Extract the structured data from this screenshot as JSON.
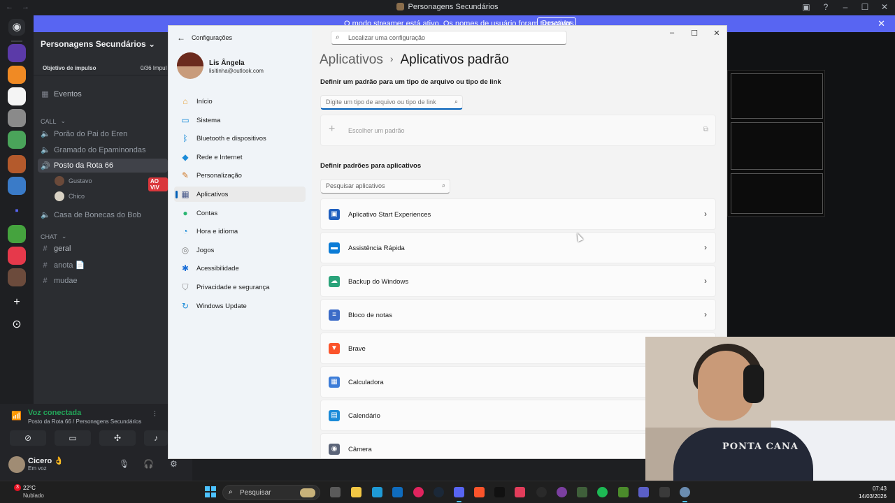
{
  "discord": {
    "window_title": "Personagens Secundários",
    "banner": {
      "text": "O modo streamer está ativo. Os nomes de usuário foram truncados.",
      "button": "Desativar"
    },
    "server_name": "Personagens Secundários",
    "boost": {
      "label": "Objetivo de impulso",
      "count": "0/36 Impul"
    },
    "channels": {
      "events": "Eventos",
      "call_category": "CALL",
      "voice": [
        "Porão do Pai do Eren",
        "Gramado do Epaminondas",
        "Posto da Rota 66"
      ],
      "voice_users": [
        "Gustavo",
        "Chico"
      ],
      "live_badge": "AO VIV",
      "voice_extra": "Casa de Bonecas do Bob",
      "chat_category": "CHAT",
      "text": [
        "geral",
        "anota 📄",
        "mudae"
      ]
    },
    "voice_panel": {
      "title": "Voz conectada",
      "subtitle": "Posto da Rota 66 / Personagens Secundários"
    },
    "user": {
      "name": "Cicero 👌",
      "status": "Em voz"
    }
  },
  "settings": {
    "app_title": "Configurações",
    "search_placeholder": "Localizar uma configuração",
    "profile": {
      "name": "Lis Ângela",
      "email": "lisitinha@outlook.com"
    },
    "nav": [
      {
        "label": "Início",
        "icon": "home-icon",
        "color": "#e8a33c"
      },
      {
        "label": "Sistema",
        "icon": "system-icon",
        "color": "#0a84d6"
      },
      {
        "label": "Bluetooth e dispositivos",
        "icon": "bluetooth-icon",
        "color": "#0a84d6"
      },
      {
        "label": "Rede e Internet",
        "icon": "wifi-icon",
        "color": "#1b8bd8"
      },
      {
        "label": "Personalização",
        "icon": "brush-icon",
        "color": "#d17a2a"
      },
      {
        "label": "Aplicativos",
        "icon": "apps-icon",
        "color": "#4a5b8c"
      },
      {
        "label": "Contas",
        "icon": "account-icon",
        "color": "#2bb673"
      },
      {
        "label": "Hora e idioma",
        "icon": "globe-clock-icon",
        "color": "#1b8bd8"
      },
      {
        "label": "Jogos",
        "icon": "gamepad-icon",
        "color": "#808080"
      },
      {
        "label": "Acessibilidade",
        "icon": "accessibility-icon",
        "color": "#1b6fd8"
      },
      {
        "label": "Privacidade e segurança",
        "icon": "shield-icon",
        "color": "#8a8a8a"
      },
      {
        "label": "Windows Update",
        "icon": "update-icon",
        "color": "#1b8bd8"
      }
    ],
    "breadcrumb": {
      "parent": "Aplicativos",
      "current": "Aplicativos padrão"
    },
    "filetype_section": "Definir um padrão para um tipo de arquivo ou tipo de link",
    "filetype_placeholder": "Digite um tipo de arquivo ou tipo de link",
    "choose_default": "Escolher um padrão",
    "apps_section": "Definir padrões para aplicativos",
    "apps_search_placeholder": "Pesquisar aplicativos",
    "apps": [
      {
        "label": "Aplicativo Start Experiences",
        "icon": "start-experiences-icon",
        "color": "#1f5fbf"
      },
      {
        "label": "Assistência Rápida",
        "icon": "quick-assist-icon",
        "color": "#0a7bd6"
      },
      {
        "label": "Backup do Windows",
        "icon": "cloud-backup-icon",
        "color": "#2aa37a"
      },
      {
        "label": "Bloco de notas",
        "icon": "notepad-icon",
        "color": "#3b6bc7"
      },
      {
        "label": "Brave",
        "icon": "brave-icon",
        "color": "#fb542b"
      },
      {
        "label": "Calculadora",
        "icon": "calculator-icon",
        "color": "#3d7dd8"
      },
      {
        "label": "Calendário",
        "icon": "calendar-icon",
        "color": "#1b8bd8"
      },
      {
        "label": "Câmera",
        "icon": "camera-icon",
        "color": "#5b6478"
      }
    ]
  },
  "webcam": {
    "shirt_text": "PONTA CANA"
  },
  "taskbar": {
    "weather": {
      "badge": "3",
      "temp": "22°C",
      "desc": "Nublado"
    },
    "search_placeholder": "Pesquisar",
    "time": "07:43",
    "date": "14/03/2026"
  }
}
